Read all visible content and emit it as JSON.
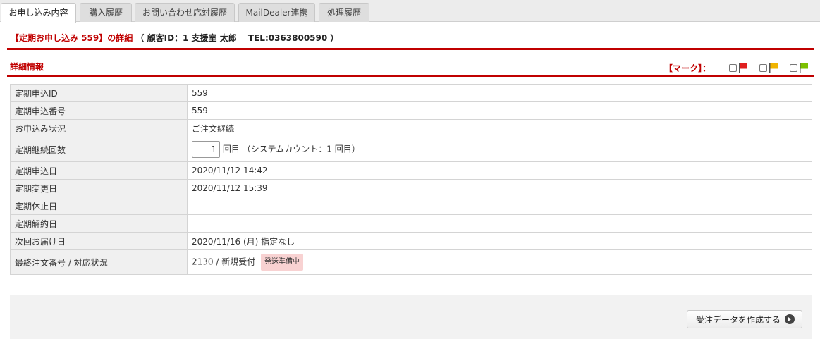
{
  "tabs": [
    {
      "label": "お申し込み内容",
      "active": true
    },
    {
      "label": "購入履歴",
      "active": false
    },
    {
      "label": "お問い合わせ応対履歴",
      "active": false
    },
    {
      "label": "MailDealer連携",
      "active": false
    },
    {
      "label": "処理履歴",
      "active": false
    }
  ],
  "header": {
    "title_prefix": "【定期お申し込み 559】の詳細",
    "customer_info": "（ 顧客ID：1 支援室 太郎　 TEL:0363800590 ）"
  },
  "section": {
    "title": "詳細情報",
    "mark_label": "【マーク】："
  },
  "marks": [
    {
      "color": "#e02020",
      "icon": "red-flag-icon"
    },
    {
      "color": "#f0b400",
      "icon": "yellow-flag-icon"
    },
    {
      "color": "#7cc000",
      "icon": "green-flag-icon"
    }
  ],
  "details": [
    {
      "label": "定期申込ID",
      "value": "559"
    },
    {
      "label": "定期申込番号",
      "value": "559"
    },
    {
      "label": "お申込み状況",
      "value": "ご注文継続"
    },
    {
      "label": "定期継続回数",
      "count_value": "1",
      "count_suffix": "回目 （システムカウント：1 回目）"
    },
    {
      "label": "定期申込日",
      "value": "2020/11/12 14:42"
    },
    {
      "label": "定期変更日",
      "value": "2020/11/12 15:39"
    },
    {
      "label": "定期休止日",
      "value": ""
    },
    {
      "label": "定期解約日",
      "value": ""
    },
    {
      "label": "次回お届け日",
      "value": "2020/11/16 (月) 指定なし"
    },
    {
      "label": "最終注文番号 / 対応状況",
      "value": "2130 / 新規受付",
      "badge": "発送準備中"
    }
  ],
  "footer": {
    "create_button": "受注データを作成する"
  }
}
